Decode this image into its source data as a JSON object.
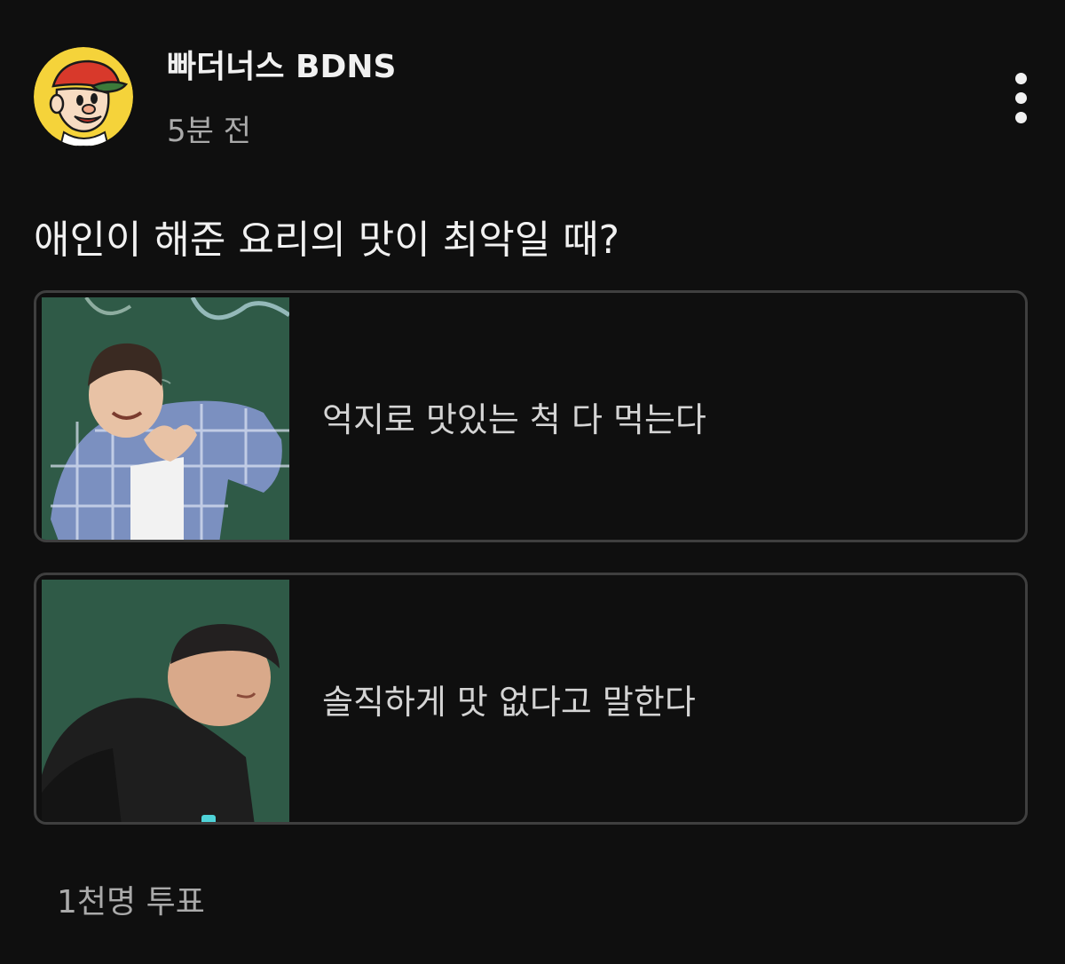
{
  "post": {
    "channel_name": "빠더너스 BDNS",
    "timestamp": "5분 전",
    "menu_icon": "more-vert-icon",
    "avatar_icon": "cartoon-boy-with-cap-avatar"
  },
  "poll": {
    "question": "애인이 해준 요리의 맛이 최악일 때?",
    "options": [
      {
        "label": "억지로 맛있는 척 다 먹는다",
        "thumbnail": "person-making-heart-gesture-photo"
      },
      {
        "label": "솔직하게 맛 없다고 말한다",
        "thumbnail": "person-bending-over-photo"
      }
    ],
    "vote_count": "1천명 투표"
  },
  "colors": {
    "background": "#0f0f0f",
    "text_primary": "#f1f1f1",
    "text_secondary": "#aaaaaa",
    "option_border": "#3f3f3f",
    "chalkboard": "#2f5a47"
  }
}
